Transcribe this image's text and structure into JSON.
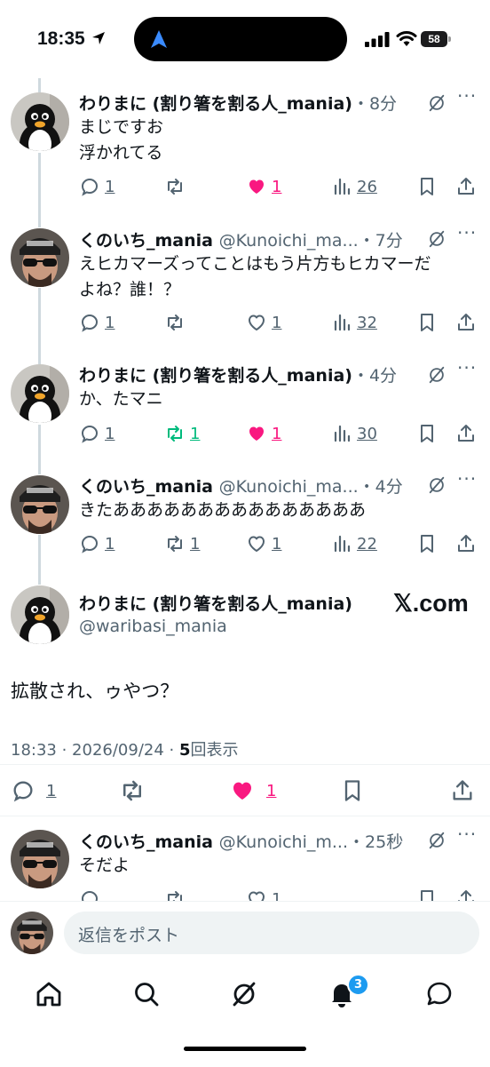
{
  "status_bar": {
    "time": "18:35",
    "battery": "58"
  },
  "replies_above": [
    {
      "name": "わりまに (割り箸を割る人_mania)",
      "handle": "",
      "time": "・8分",
      "text": "まじですお\n浮かれてる",
      "reply_count": "1",
      "repost_count": "",
      "like_count": "1",
      "views": "26",
      "liked": true,
      "reposted": false,
      "avatar": "penguin"
    },
    {
      "name": "くのいち_mania",
      "handle": "@Kunoichi_ma...",
      "time": "・7分",
      "text": "えヒカマーズってことはもう片方もヒカマーだ\nよね？誰！？",
      "reply_count": "1",
      "repost_count": "",
      "like_count": "1",
      "views": "32",
      "liked": false,
      "reposted": false,
      "avatar": "man"
    },
    {
      "name": "わりまに (割り箸を割る人_mania)",
      "handle": "",
      "time": "・4分",
      "text": "か、たマニ",
      "reply_count": "1",
      "repost_count": "1",
      "like_count": "1",
      "views": "30",
      "liked": true,
      "reposted": true,
      "avatar": "penguin"
    },
    {
      "name": "くのいち_mania",
      "handle": "@Kunoichi_ma...",
      "time": "・4分",
      "text": "きたあああああああああああああああ",
      "reply_count": "1",
      "repost_count": "1",
      "like_count": "1",
      "views": "22",
      "liked": false,
      "reposted": false,
      "avatar": "man"
    }
  ],
  "main_post": {
    "name": "わりまに (割り箸を割る人_mania)",
    "handle": "@waribasi_mania",
    "watermark": "𝕏.com",
    "text": "拡散され、ゥやつ？",
    "timestamp": "18:33 · 2026/09/24 · ",
    "view_count": "5",
    "view_label": "回表示",
    "reply_count": "1",
    "like_count": "1"
  },
  "reply_below": {
    "name": "くのいち_mania",
    "handle": "@Kunoichi_m...",
    "time": "・25秒",
    "text": "そだよ",
    "like_count": "1"
  },
  "composer": {
    "placeholder": "返信をポスト"
  },
  "tabbar": {
    "notification_badge": "3"
  },
  "colors": {
    "like": "#f91880",
    "repost": "#00ba7c",
    "accent": "#1d9bf0",
    "muted": "#536471"
  }
}
